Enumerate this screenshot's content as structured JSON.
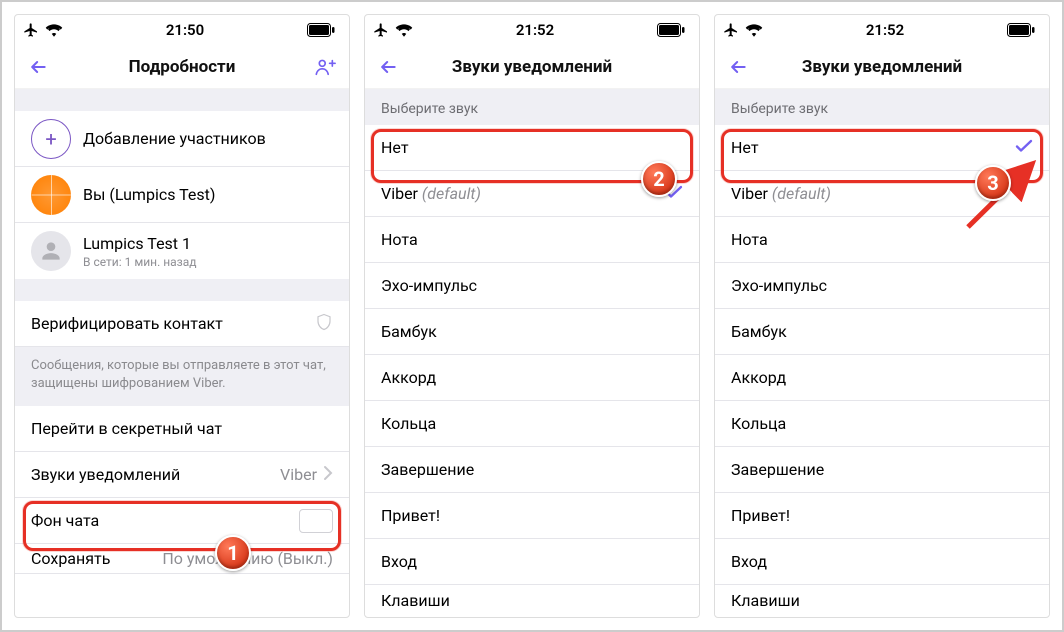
{
  "status": {
    "time1": "21:50",
    "time2": "21:52",
    "time3": "21:52"
  },
  "screen1": {
    "title": "Подробности",
    "add_label": "Добавление участников",
    "you_label": "Вы (Lumpics Test)",
    "member_name": "Lumpics Test 1",
    "member_status": "В сети: 1 мин. назад",
    "verify_label": "Верифицировать контакт",
    "encryption_note": "Сообщения, которые вы отправляете в этот чат, защищены шифрованием Viber.",
    "secret_label": "Перейти в секретный чат",
    "sounds_label": "Звуки уведомлений",
    "sounds_value": "Viber",
    "background_label": "Фон чата",
    "save_label": "Сохранять",
    "save_value_faded": "По умолчанию (Выкл.)"
  },
  "sounds_screen": {
    "title": "Звуки уведомлений",
    "section": "Выберите звук",
    "options": {
      "none": "Нет",
      "viber": "Viber",
      "default_suffix": " (default)",
      "nota": "Нота",
      "echo": "Эхо-импульс",
      "bamboo": "Бамбук",
      "chord": "Аккорд",
      "circles": "Кольца",
      "complete": "Завершение",
      "hello": "Привет!",
      "input": "Вход",
      "keys_cut": "Клавиши"
    }
  },
  "badges": {
    "b1": "1",
    "b2": "2",
    "b3": "3"
  }
}
